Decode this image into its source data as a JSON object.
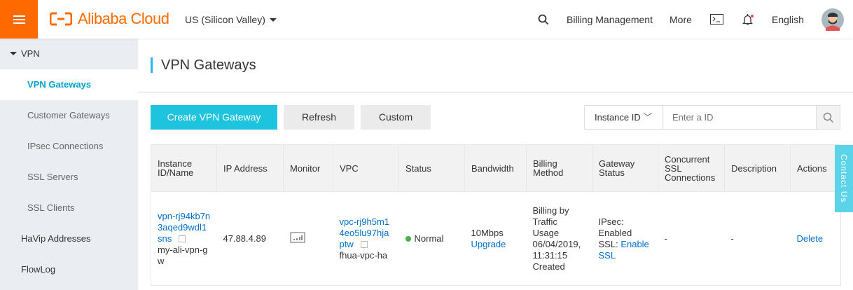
{
  "header": {
    "logo": "Alibaba Cloud",
    "region": "US (Silicon Valley)",
    "billing": "Billing Management",
    "more": "More",
    "language": "English"
  },
  "sidebar": {
    "group": "VPN",
    "items": [
      "VPN Gateways",
      "Customer Gateways",
      "IPsec Connections",
      "SSL Servers",
      "SSL Clients"
    ],
    "others": [
      "HaVip Addresses",
      "FlowLog"
    ]
  },
  "page": {
    "title": "VPN Gateways"
  },
  "toolbar": {
    "create": "Create VPN Gateway",
    "refresh": "Refresh",
    "custom": "Custom",
    "filter": "Instance ID",
    "placeholder": "Enter a ID"
  },
  "table": {
    "headers": [
      "Instance ID/Name",
      "IP Address",
      "Monitor",
      "VPC",
      "Status",
      "Bandwidth",
      "Billing Method",
      "Gateway Status",
      "Concurrent SSL Connections",
      "Description",
      "Actions"
    ],
    "row": {
      "id": "vpn-rj94kb7n3aqed9wdl1sns",
      "name": "my-ali-vpn-gw",
      "ip": "47.88.4.89",
      "vpc_id": "vpc-rj9h5m14eo5lu97hjaptw",
      "vpc_name": "fhua-vpc-ha",
      "status": "Normal",
      "bandwidth": "10Mbps",
      "upgrade": "Upgrade",
      "billing": "Billing by Traffic Usage",
      "created": "06/04/2019, 11:31:15 Created",
      "ipsec": "IPsec: Enabled",
      "ssl": "SSL:",
      "enable_ssl": "Enable SSL",
      "ssl_conn": "-",
      "description": "-",
      "delete": "Delete"
    }
  },
  "contact": "Contact Us"
}
